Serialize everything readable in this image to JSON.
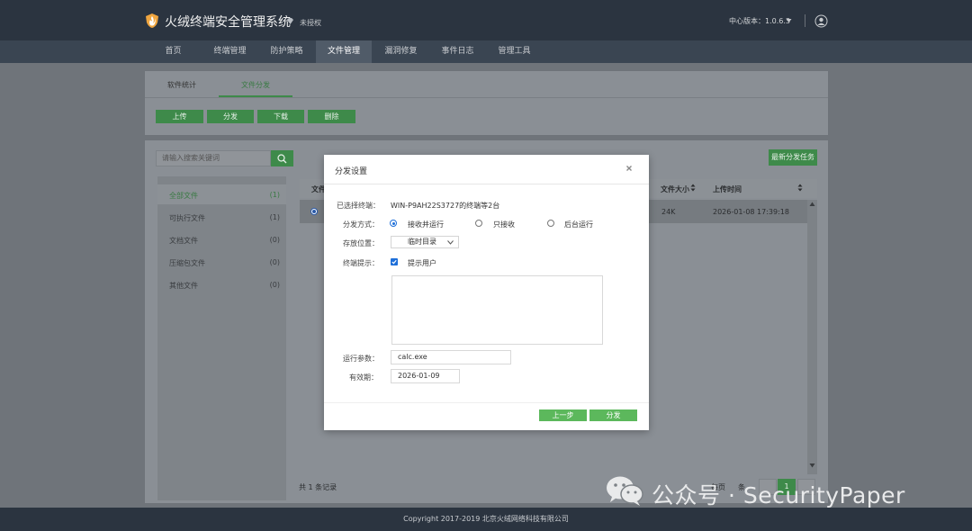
{
  "header": {
    "title": "火绒终端安全管理系统",
    "license": "未授权",
    "version": "中心版本：1.0.6.3",
    "icons": {
      "logo": "huorong-shield-logo",
      "license": "diamond-icon",
      "caret": "chevron-down-icon",
      "user": "user-icon"
    }
  },
  "nav": {
    "items": [
      "首页",
      "终端管理",
      "防护策略",
      "文件管理",
      "漏洞修复",
      "事件日志",
      "管理工具"
    ],
    "active": "文件管理"
  },
  "subtabs": [
    "软件统计",
    "文件分发"
  ],
  "toolbar": {
    "upload": "上传",
    "distribute": "分发",
    "download": "下载",
    "delete": "删除"
  },
  "search": {
    "placeholder": "请输入搜索关键词"
  },
  "new_task": "最新分发任务",
  "sidebar": {
    "items": [
      {
        "label": "全部文件",
        "count": "(1)"
      },
      {
        "label": "可执行文件",
        "count": "(1)"
      },
      {
        "label": "文档文件",
        "count": "(0)"
      },
      {
        "label": "压缩包文件",
        "count": "(0)"
      },
      {
        "label": "其他文件",
        "count": "(0)"
      }
    ]
  },
  "table": {
    "headers": {
      "file": "文件",
      "size": "文件大小",
      "time": "上传时间"
    },
    "rows": [
      {
        "size": "24K",
        "time": "2026-01-08 17:39:18"
      }
    ]
  },
  "pagination": {
    "total": "共 1 条记录",
    "frag1": "每页",
    "frag2": "条",
    "current": "1"
  },
  "modal": {
    "title": "分发设置",
    "selected_label": "已选择终端：",
    "selected_value": "WIN-P9AH22S3727的终端等2台",
    "mode_label": "分发方式：",
    "mode_options": [
      "接收并运行",
      "只接收",
      "后台运行"
    ],
    "location_label": "存放位置：",
    "location_value": "临时目录",
    "prompt_label": "终端提示：",
    "prompt_option": "提示用户",
    "args_label": "运行参数：",
    "args_value": "calc.exe",
    "expiry_label": "有效期：",
    "expiry_value": "2026-01-09",
    "prev_button": "上一步",
    "submit_button": "分发"
  },
  "watermark": "公众号 · SecurityPaper",
  "footer": "Copyright 2017-2019 北京火绒网络科技有限公司",
  "colors": {
    "header": "#2b3440",
    "nav": "#3a4552",
    "accent": "#3e8a4a",
    "button": "#5cb85c",
    "radio": "#1e6fd9"
  }
}
